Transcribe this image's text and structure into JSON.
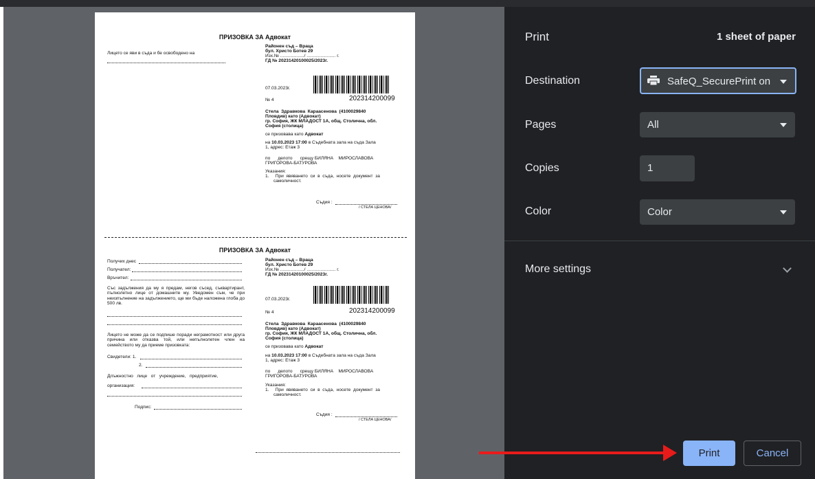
{
  "panel": {
    "title": "Print",
    "sheets": "1 sheet of paper",
    "destination_label": "Destination",
    "destination_value": "SafeQ_SecurePrint on",
    "pages_label": "Pages",
    "pages_value": "All",
    "copies_label": "Copies",
    "copies_value": "1",
    "color_label": "Color",
    "color_value": "Color",
    "more_settings": "More settings",
    "print_button": "Print",
    "cancel_button": "Cancel",
    "accent_color": "#8ab4f8"
  },
  "document": {
    "heading": "ПРИЗОВКА ЗА Адвокат",
    "top_left_text": "Лицето  се  яви  в  съда  и  бе  освободено  на",
    "court": "Районен съд – Враца",
    "address": "бул. Христо Ботев 29",
    "outgoing": "Изх.№ .................../ ....................... г.",
    "case_no": "ГД № 20231420100025/2023г.",
    "date": "07.03.2023г.",
    "number": "№ 4",
    "barcode_number": "202314200099",
    "person_line1": "Стела  Здравкова  Караасенова  (4100029840",
    "person_line2": "Пловдив) като (Адвокат)",
    "person_line3": "гр. София, ЖК МЛАДОСТ 1А, общ. Столична, обл.",
    "person_line4": "София (столица)",
    "summoned_prefix": "се призовава като",
    "summoned_role": "Адвокат",
    "hearing_prefix": "на",
    "hearing_datetime": "10.03.2023 17:00",
    "hearing_rest": "в Съдебната зала на съда Зала",
    "hearing_line2": "1, адрес: Етаж 3",
    "case_line1": "по      делото      срещу БИЛЯНА    МИРОСЛАВОВА",
    "case_line2": "ГРИГОРОВА-БАТУРОВА",
    "instructions_title": "Указания:",
    "instruction1": "1.     При  явяването  си  в  съда,  носете  документ  за",
    "instruction1b": "самоличност.",
    "judge_label": "Съдия :",
    "judge_name": "/ СТЕЛА ЦЕНОВА/",
    "received": "Получих днес",
    "recipient": "Получател:",
    "deliverer": "Връчител:",
    "neighbor_text": "Със  задължения  да  му  я  предам,  негов  съсед, съквартирант, пълнолетно лице от домашните му. Уведомен   съм,   че   при   неизпълнение   на задължението, ще ми бъде наложена глоба до 500 лв.",
    "refusal_text": "Лицето не може да се подпише поради неграмотност или друга причина или отказва той, или непълнолетен член на семейството му да приеме призовката:",
    "witnesses": "Свидетели: 1.",
    "witness2": "2.",
    "official": "Длъжностно   лице   от   учреждение,   предприятие,",
    "organization": "организация:",
    "signature": "Подпис:"
  }
}
